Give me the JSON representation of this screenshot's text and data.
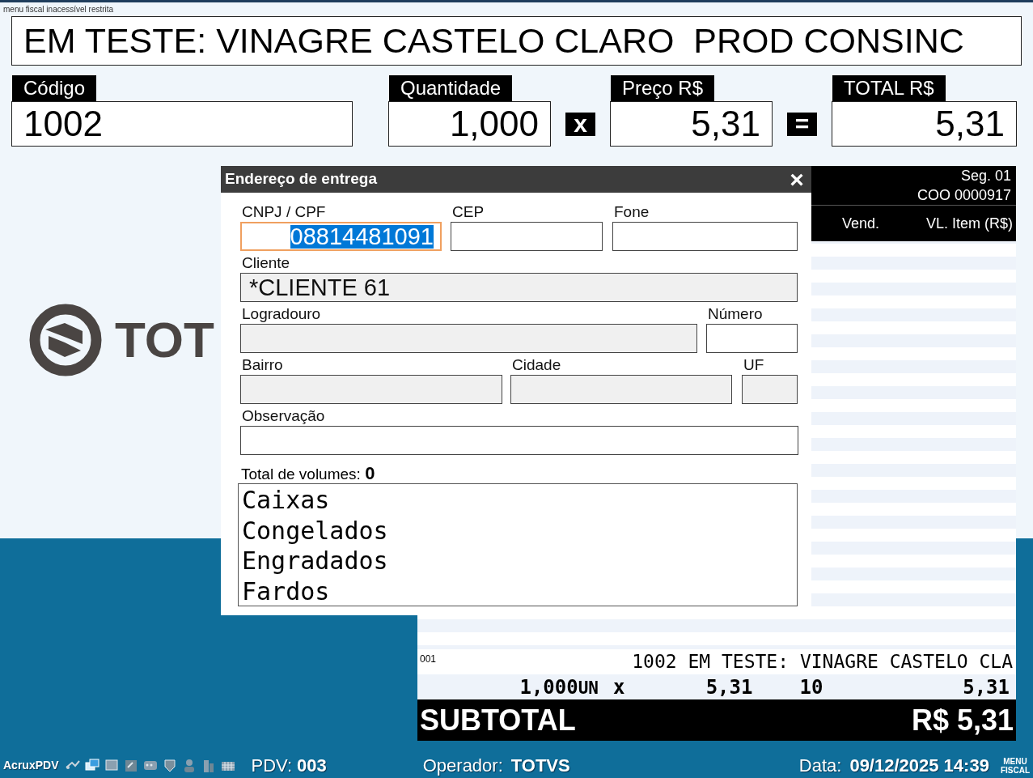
{
  "top_note": "menu fiscal inacessível restrita",
  "description": "EM TESTE: VINAGRE CASTELO CLARO  PROD CONSINC",
  "entry": [
    {
      "kind": "field",
      "label": "Código",
      "value": "1002"
    },
    {
      "kind": "field",
      "label": "Quantidade",
      "value": "1,000"
    },
    {
      "kind": "operator",
      "symbol": "x"
    },
    {
      "kind": "field",
      "label": "Preço R$",
      "value": "5,31"
    },
    {
      "kind": "operator",
      "symbol": "="
    },
    {
      "kind": "field",
      "label": "TOTAL R$",
      "value": "5,31"
    }
  ],
  "logo": {
    "text": "TOT"
  },
  "receipt": {
    "header_lines": [
      "Seg. 01",
      "COO 0000917"
    ],
    "columns": [
      "Vend.",
      "VL. Item (R$)"
    ],
    "items": [
      {
        "index": "001",
        "code": "1002",
        "description": "EM TESTE: VINAGRE CASTELO CLA",
        "quantity": "1,000",
        "unit": "UN",
        "times": "x",
        "price": "5,31",
        "vendor": "10",
        "total": "5,31"
      }
    ],
    "subtotal_label": "SUBTOTAL",
    "subtotal_value": "R$ 5,31"
  },
  "dialog": {
    "title": "Endereço de entrega",
    "close": "×",
    "rows": [
      [
        {
          "label": "CNPJ / CPF",
          "value": "08814481091",
          "focused": true,
          "disabled": false
        },
        {
          "label": "CEP",
          "focused": false,
          "disabled": false
        },
        {
          "label": "Fone",
          "focused": false,
          "disabled": false
        }
      ],
      [
        {
          "label": "Cliente",
          "value": "*CLIENTE 61",
          "focused": false,
          "disabled": true
        }
      ],
      [
        {
          "label": "Logradouro",
          "focused": false,
          "disabled": true
        },
        {
          "label": "Número",
          "focused": false,
          "disabled": false
        }
      ],
      [
        {
          "label": "Bairro",
          "focused": false,
          "disabled": true
        },
        {
          "label": "Cidade",
          "focused": false,
          "disabled": true
        },
        {
          "label": "UF",
          "focused": false,
          "disabled": true
        }
      ],
      [
        {
          "label": "Observação",
          "focused": false,
          "disabled": false
        }
      ]
    ],
    "volumes_label": "Total de volumes:",
    "volumes_value": "0",
    "volume_types": [
      {
        "label": "Caixas"
      },
      {
        "label": "Congelados"
      },
      {
        "label": "Engradados"
      },
      {
        "label": "Fardos"
      }
    ]
  },
  "status_bar": {
    "app": "AcruxPDV",
    "pdv_label": "PDV:",
    "pdv": "003",
    "operator_label": "Operador:",
    "operator": "TOTVS",
    "date_label": "Data:",
    "date": "09/12/2025 14:39",
    "menu_fiscal": [
      "MENU",
      "FISCAL"
    ]
  }
}
